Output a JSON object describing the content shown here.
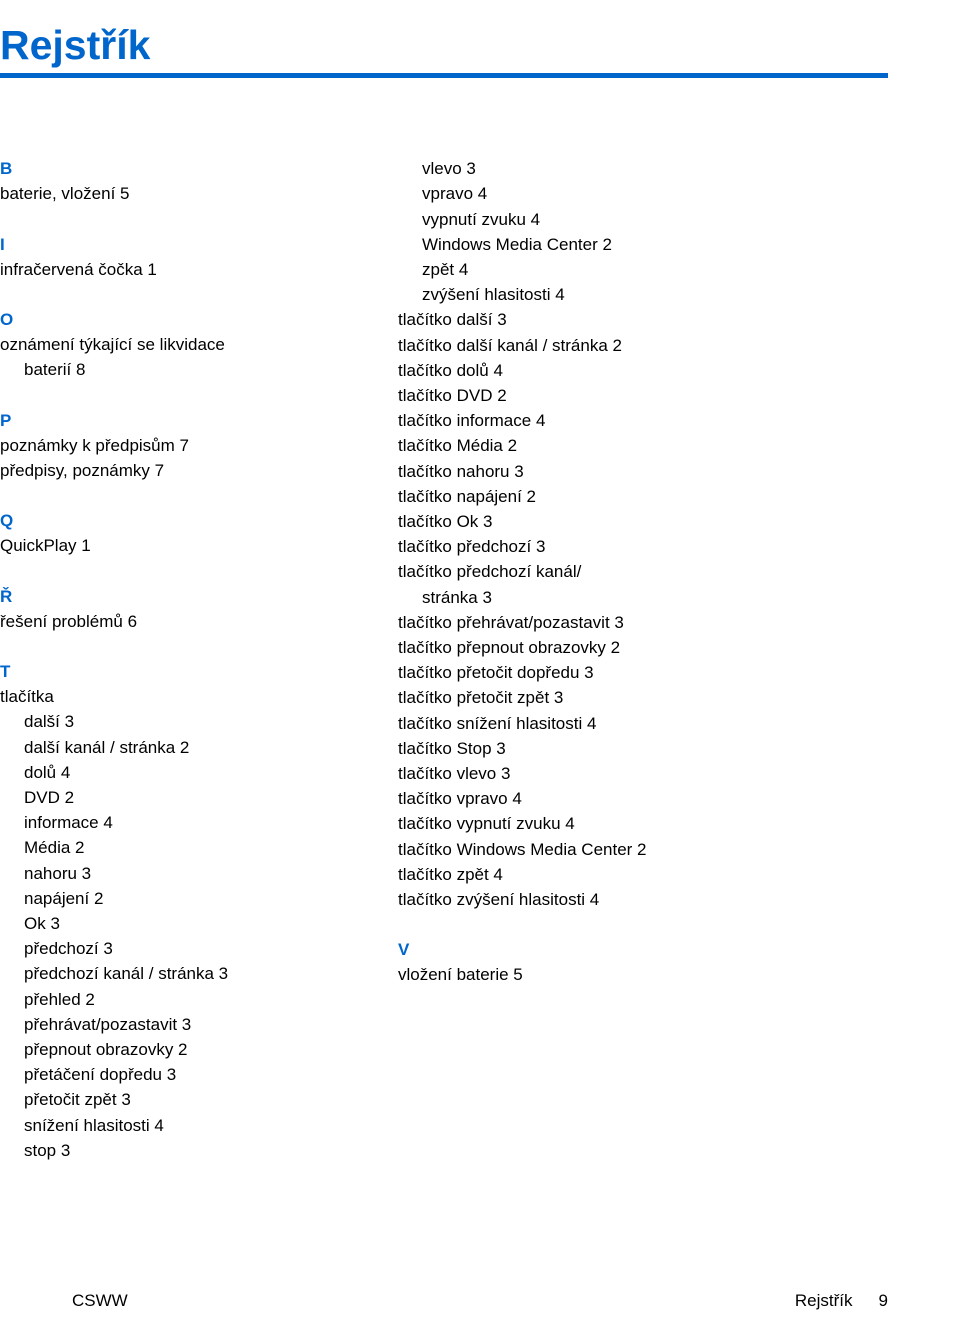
{
  "title": "Rejstřík",
  "col1": [
    {
      "kind": "letter",
      "text": "B"
    },
    {
      "kind": "entry",
      "text": "baterie, vložení   5"
    },
    {
      "kind": "spacer"
    },
    {
      "kind": "letter",
      "text": "I"
    },
    {
      "kind": "entry",
      "text": "infračervená čočka   1"
    },
    {
      "kind": "spacer"
    },
    {
      "kind": "letter",
      "text": "O"
    },
    {
      "kind": "entry",
      "text": "oznámení týkající se likvidace"
    },
    {
      "kind": "sub1",
      "text": "baterií   8"
    },
    {
      "kind": "spacer"
    },
    {
      "kind": "letter",
      "text": "P"
    },
    {
      "kind": "entry",
      "text": "poznámky k předpisům   7"
    },
    {
      "kind": "entry",
      "text": "předpisy, poznámky   7"
    },
    {
      "kind": "spacer"
    },
    {
      "kind": "letter",
      "text": "Q"
    },
    {
      "kind": "entry",
      "text": "QuickPlay   1"
    },
    {
      "kind": "spacer"
    },
    {
      "kind": "letter",
      "text": "Ř"
    },
    {
      "kind": "entry",
      "text": "řešení problémů   6"
    },
    {
      "kind": "spacer"
    },
    {
      "kind": "letter",
      "text": "T"
    },
    {
      "kind": "entry",
      "text": "tlačítka"
    },
    {
      "kind": "sub1",
      "text": "další   3"
    },
    {
      "kind": "sub1",
      "text": "další kanál / stránka   2"
    },
    {
      "kind": "sub1",
      "text": "dolů   4"
    },
    {
      "kind": "sub1",
      "text": "DVD   2"
    },
    {
      "kind": "sub1",
      "text": "informace   4"
    },
    {
      "kind": "sub1",
      "text": "Média   2"
    },
    {
      "kind": "sub1",
      "text": "nahoru   3"
    },
    {
      "kind": "sub1",
      "text": "napájení   2"
    },
    {
      "kind": "sub1",
      "text": "Ok   3"
    },
    {
      "kind": "sub1",
      "text": "předchozí   3"
    },
    {
      "kind": "sub1",
      "text": "předchozí kanál / stránka   3"
    },
    {
      "kind": "sub1",
      "text": "přehled   2"
    },
    {
      "kind": "sub1",
      "text": "přehrávat/pozastavit   3"
    },
    {
      "kind": "sub1",
      "text": "přepnout obrazovky   2"
    },
    {
      "kind": "sub1",
      "text": "přetáčení dopředu   3"
    },
    {
      "kind": "sub1",
      "text": "přetočit zpět   3"
    },
    {
      "kind": "sub1",
      "text": "snížení hlasitosti   4"
    },
    {
      "kind": "sub1",
      "text": "stop   3"
    }
  ],
  "col2": [
    {
      "kind": "sub1",
      "text": "vlevo   3"
    },
    {
      "kind": "sub1",
      "text": "vpravo   4"
    },
    {
      "kind": "sub1",
      "text": "vypnutí zvuku   4"
    },
    {
      "kind": "sub1",
      "text": "Windows Media Center   2"
    },
    {
      "kind": "sub1",
      "text": "zpět   4"
    },
    {
      "kind": "sub1",
      "text": "zvýšení hlasitosti   4"
    },
    {
      "kind": "entry",
      "text": "tlačítko další   3"
    },
    {
      "kind": "entry",
      "text": "tlačítko další kanál / stránka   2"
    },
    {
      "kind": "entry",
      "text": "tlačítko dolů   4"
    },
    {
      "kind": "entry",
      "text": "tlačítko DVD   2"
    },
    {
      "kind": "entry",
      "text": "tlačítko informace   4"
    },
    {
      "kind": "entry",
      "text": "tlačítko Média   2"
    },
    {
      "kind": "entry",
      "text": "tlačítko nahoru   3"
    },
    {
      "kind": "entry",
      "text": "tlačítko napájení   2"
    },
    {
      "kind": "entry",
      "text": "tlačítko Ok   3"
    },
    {
      "kind": "entry",
      "text": "tlačítko předchozí   3"
    },
    {
      "kind": "entry",
      "text": "tlačítko předchozí kanál/"
    },
    {
      "kind": "sub1",
      "text": "stránka   3"
    },
    {
      "kind": "entry",
      "text": "tlačítko přehrávat/pozastavit   3"
    },
    {
      "kind": "entry",
      "text": "tlačítko přepnout obrazovky   2"
    },
    {
      "kind": "entry",
      "text": "tlačítko přetočit dopředu   3"
    },
    {
      "kind": "entry",
      "text": "tlačítko přetočit zpět   3"
    },
    {
      "kind": "entry",
      "text": "tlačítko snížení hlasitosti   4"
    },
    {
      "kind": "entry",
      "text": "tlačítko Stop   3"
    },
    {
      "kind": "entry",
      "text": "tlačítko vlevo   3"
    },
    {
      "kind": "entry",
      "text": "tlačítko vpravo   4"
    },
    {
      "kind": "entry",
      "text": "tlačítko vypnutí zvuku   4"
    },
    {
      "kind": "entry",
      "text": "tlačítko Windows Media Center   2"
    },
    {
      "kind": "entry",
      "text": "tlačítko zpět   4"
    },
    {
      "kind": "entry",
      "text": "tlačítko zvýšení hlasitosti   4"
    },
    {
      "kind": "spacer"
    },
    {
      "kind": "letter",
      "text": "V"
    },
    {
      "kind": "entry",
      "text": "vložení baterie   5"
    }
  ],
  "footer": {
    "left": "CSWW",
    "right_label": "Rejstřík",
    "page": "9"
  }
}
